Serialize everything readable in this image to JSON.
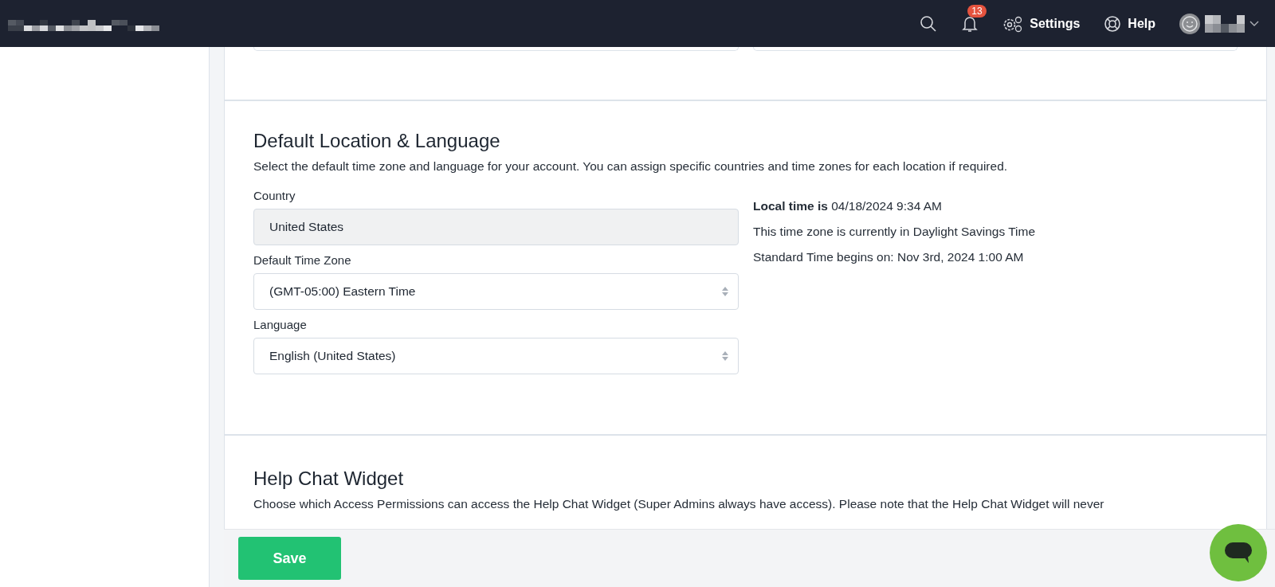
{
  "topbar": {
    "notifications": {
      "count": "13"
    },
    "links": [
      {
        "kind": "settings",
        "label": "Settings"
      },
      {
        "kind": "help",
        "label": "Help"
      }
    ]
  },
  "location_section": {
    "title": "Default Location & Language",
    "description": "Select the default time zone and language for your account. You can assign specific countries and time zones for each location if required.",
    "fields": [
      {
        "label": "Country",
        "value": "United States",
        "disabled": true
      },
      {
        "label": "Default Time Zone",
        "value": "(GMT-05:00) Eastern Time",
        "disabled": false
      },
      {
        "label": "Language",
        "value": "English (United States)",
        "disabled": false
      }
    ],
    "local_time": "**Local time is** 04/18/2024 9:34 AM",
    "info": [
      "This time zone is currently in Daylight Savings Time",
      "Standard Time begins on: Nov 3rd, 2024 1:00 AM"
    ]
  },
  "help_chat_section": {
    "title": "Help Chat Widget",
    "description": "Choose which Access Permissions can access the Help Chat Widget (Super Admins always have access). Please note that the Help Chat Widget will never"
  },
  "save_button": "Save"
}
